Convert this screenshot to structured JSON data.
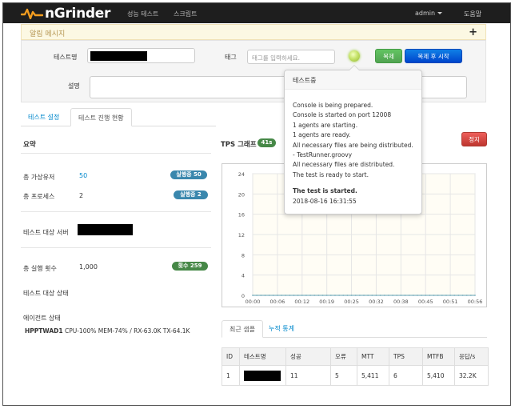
{
  "nav": {
    "brand": "nGrinder",
    "links": [
      "성능 테스트",
      "스크립트"
    ],
    "user": "admin",
    "help": "도움말"
  },
  "alert": {
    "title": "알림 메시지",
    "toggle": "+"
  },
  "form": {
    "test_name_label": "테스트명",
    "tag_label": "태그",
    "tag_placeholder": "태그를 입력하세요.",
    "description_label": "설명",
    "clone_button": "복제",
    "clone_start_button": "복제 후 시작"
  },
  "popover": {
    "title": "테스트중",
    "lines": [
      "Console is being prepared.",
      "Console is started on port 12008",
      "1 agents are starting.",
      "1 agents are ready.",
      "All necessary files are being distributed.",
      "- TestRunner.groovy",
      "All necessary files are distributed.",
      "The test is ready to start."
    ],
    "started": "The test is started.",
    "timestamp": "2018-08-16 16:31:55"
  },
  "tabs": [
    "테스트 설정",
    "테스트 진행 현황"
  ],
  "summary": {
    "title": "요약",
    "vusers_label": "총 가상유저",
    "vusers_value": "50",
    "vusers_badge": "실행중 50",
    "processes_label": "총 프로세스",
    "processes_value": "2",
    "processes_badge": "실행중 2",
    "target_server_label": "테스트 대상 서버",
    "runs_label": "총 실행 횟수",
    "runs_value": "1,000",
    "runs_badge": "횟수 259",
    "target_status_label": "테스트 대상 상태",
    "agent_status_label": "에이전트 상태",
    "agent_name": "HPPTWAD1",
    "agent_stats": "CPU-100% MEM-74% / RX-63.0K TX-64.1K"
  },
  "tps": {
    "title": "TPS 그래프",
    "elapsed_badge": "41s",
    "stop_button": "정지"
  },
  "chart_data": {
    "type": "line",
    "title": "",
    "xlabel": "",
    "ylabel": "",
    "ylim": [
      0,
      24
    ],
    "yticks": [
      0,
      4,
      8,
      12,
      16,
      20,
      24
    ],
    "xticks": [
      "00:00",
      "00:06",
      "00:12",
      "00:19",
      "00:25",
      "00:32",
      "00:38",
      "00:45",
      "00:51",
      "00:56"
    ],
    "x": [
      0,
      0.07,
      0.14,
      0.21,
      0.28,
      0.35,
      0.42,
      0.49,
      0.56,
      0.63,
      0.7,
      0.77,
      0.84,
      0.91,
      0.98,
      1.05,
      1.12,
      1.19,
      1.26,
      1.33,
      1.4,
      1.47,
      1.54,
      1.61,
      1.68,
      1.75,
      1.82,
      1.89,
      1.96,
      2.03,
      2.1,
      2.17,
      2.24,
      2.31,
      2.38,
      2.45,
      2.52,
      2.59,
      2.66,
      2.73,
      2.8,
      2.87,
      2.94,
      3.01,
      3.08,
      3.15,
      3.22,
      3.29,
      3.36,
      3.43,
      3.5,
      3.57,
      3.64,
      3.71,
      3.78
    ],
    "series": [
      {
        "color": "#7fb2c0",
        "fill": "#eef5f7",
        "values": [
          0,
          0,
          0,
          0,
          0,
          0,
          0,
          0,
          0,
          0,
          0,
          0,
          0,
          0,
          0,
          0,
          0,
          0,
          0,
          0,
          0,
          0,
          0,
          0,
          0,
          0,
          0,
          0,
          0,
          0,
          0,
          0,
          0,
          0,
          0,
          0,
          0,
          0,
          0,
          0,
          0,
          0,
          0,
          0,
          0,
          0,
          0,
          0,
          0,
          0,
          0,
          0,
          0,
          0,
          0
        ]
      }
    ]
  },
  "recent": {
    "tabs": [
      "최근 샘플",
      "누적 통계"
    ],
    "columns": [
      "ID",
      "테스트명",
      "성공",
      "오류",
      "MTT",
      "TPS",
      "MTFB",
      "응답/s"
    ],
    "row": {
      "id": "1",
      "success": "11",
      "errors": "5",
      "mtt": "5,411",
      "tps": "6",
      "mtfb": "5,410",
      "rate": "32.2K"
    }
  }
}
